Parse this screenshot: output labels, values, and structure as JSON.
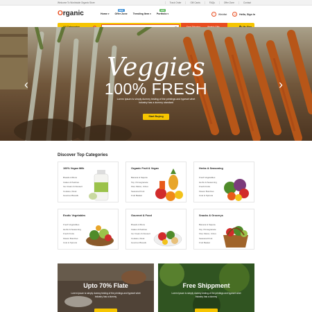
{
  "topbar": {
    "welcome": "Welcome To Worldwide Organic Store",
    "links": [
      "Track Order",
      "Gift Cards",
      "FAQs",
      "Offer Zone",
      "Contact"
    ]
  },
  "header": {
    "logo_first": "O",
    "logo_rest": "rganic",
    "nav": [
      {
        "label": "Home",
        "badge": "",
        "caret": true
      },
      {
        "label": "Offer Zone",
        "badge": "NEW",
        "badge_color": "#3d8fd6",
        "caret": false
      },
      {
        "label": "Trending Item",
        "badge": "",
        "caret": true
      },
      {
        "label": "Portfolio",
        "badge": "HOT",
        "badge_color": "#5cb85c",
        "caret": true
      }
    ],
    "wishlist_label": "Wishlist",
    "account_label": "Hello, Sign In"
  },
  "searchbar": {
    "all_categories": "All Categories",
    "placeholder": "I'm shopping for...",
    "free_shipping": "Free Shipping",
    "weekly_gifts": "Weekly Gifts",
    "bag_label": "My Bag",
    "bag_count": "0"
  },
  "hero": {
    "script_title": "Veggies",
    "subtitle": "100% FRESH",
    "description": "Lorem Ipsum is simply dummy testing of the printings and typeset whet industry has a dummy standard",
    "button": "Start Buying"
  },
  "categories": {
    "title": "Discover Top Categories",
    "cards": [
      {
        "title": "100% Vegan Milk",
        "items": [
          "Breads & Buns",
          "Cakes & Pastries",
          "Ice Cream & Dessert",
          "Cookies, Rusk",
          "Gourmet Breads"
        ]
      },
      {
        "title": "Organic Fruit & Vegan",
        "items": [
          "Banana & Sapota",
          "Top, Pomegranate",
          "Kiwi, Melon, Citrus",
          "Seasonal Fruit",
          "Fruit Basket"
        ]
      },
      {
        "title": "Herbs & Seasoning",
        "items": [
          "Fresh Vegetables",
          "Herbs & Seasoning",
          "Fresh Fruits",
          "Flower Bunches",
          "Cuts & Sprouts"
        ]
      },
      {
        "title": "Exotic Vegetables",
        "items": [
          "Fresh Vegetables",
          "Herbs & Seasoning",
          "Fresh Fruits",
          "Flower Bunches",
          "Cuts & Sprouts"
        ]
      },
      {
        "title": "Gourmet & Food",
        "items": [
          "Breads & Buns",
          "Cakes & Pastries",
          "Ice Cream & Dessert",
          "Cookies, Rusk",
          "Gourmet Breads"
        ]
      },
      {
        "title": "Snacks & Grocerys",
        "items": [
          "Banana & Sapota",
          "Top, Pomegranate",
          "Kiwi, Melon, Citrus",
          "Seasonal Fruit",
          "Fruit Basket"
        ]
      }
    ]
  },
  "promos": [
    {
      "title": "Upto 70% Flate",
      "description": "Lorem Ipsum is simply dummy testing of the printings and typeset whet industry has a dummy"
    },
    {
      "title": "Free Shippment",
      "description": "Lorem Ipsum is simply dummy testing of the printings and typeset whet industry has a dummy"
    }
  ],
  "colors": {
    "accent": "#e94c1e",
    "yellow": "#f6c500"
  }
}
